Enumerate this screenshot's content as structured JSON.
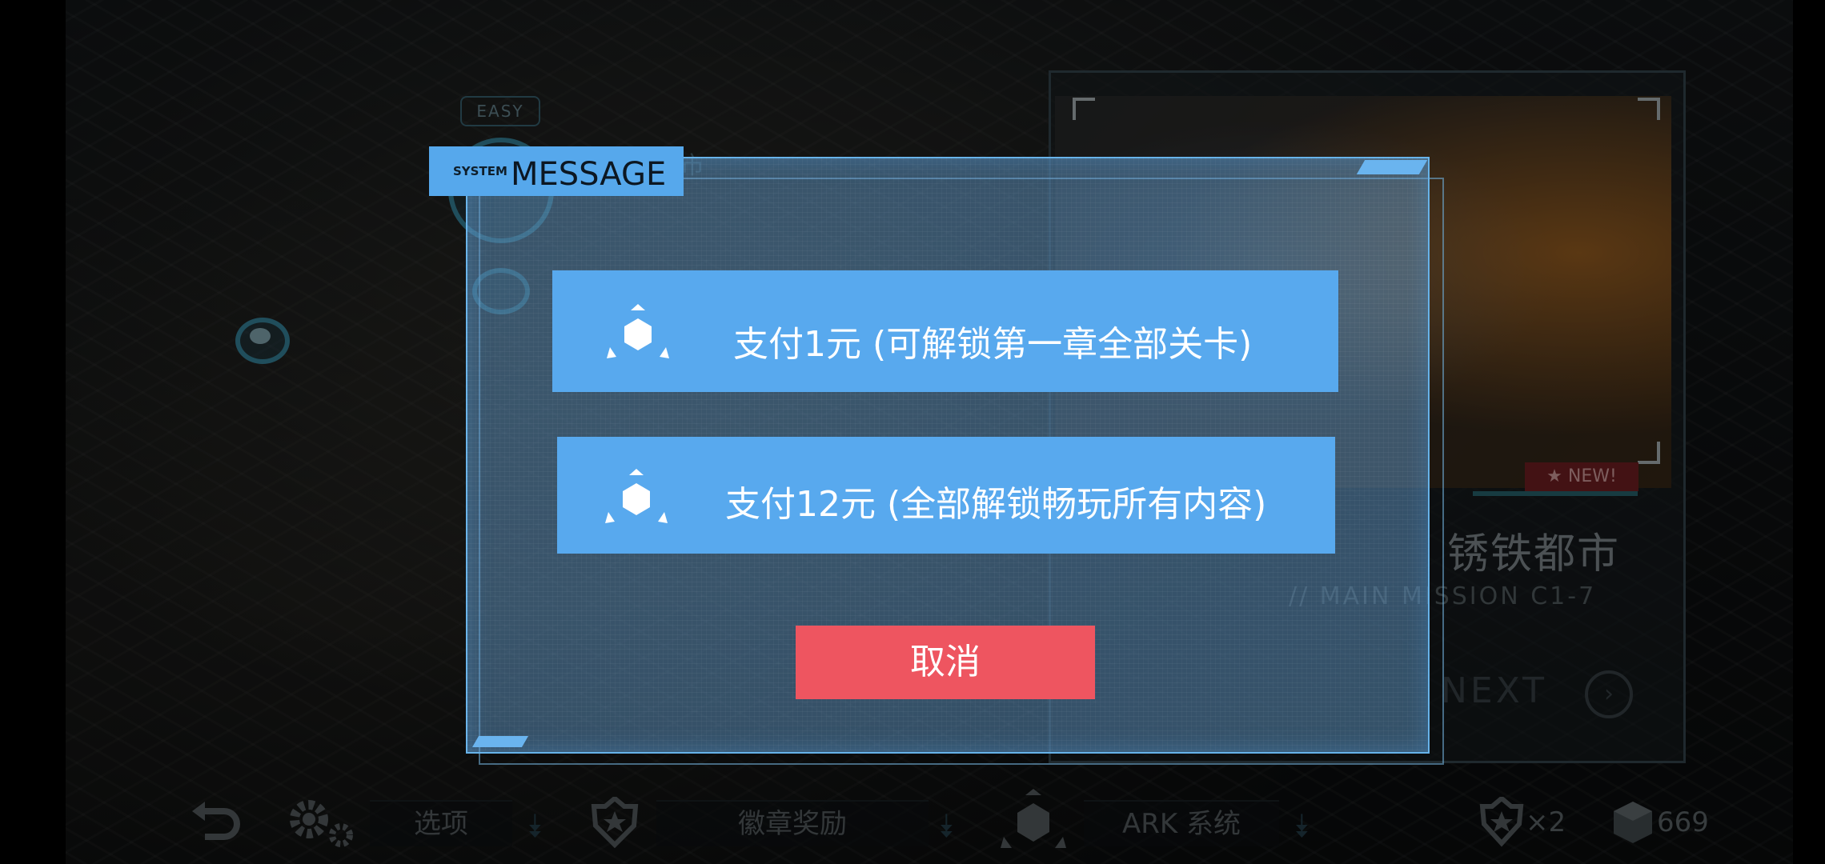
{
  "dialog": {
    "system_tag": "SYSTEM",
    "title": "MESSAGE",
    "option1_label": "支付1元 (可解锁第一章全部关卡)",
    "option2_label": "支付12元 (全部解锁畅玩所有内容)",
    "cancel_label": "取消",
    "option_icon": "cube-icon"
  },
  "background": {
    "difficulty": "EASY",
    "stage_title_partial": "都市",
    "new_badge": "★ NEW!",
    "mission_name": "锈铁都市",
    "mission_code": "// MAIN MISSION C1-7",
    "next_label": "NEXT"
  },
  "toolbar": {
    "back_icon": "back-arrow-icon",
    "settings_icon": "gears-icon",
    "options_label": "选项",
    "badge_icon": "badge-icon",
    "badge_label": "徽章奖励",
    "ark_icon": "cube-icon",
    "ark_label": "ARK 系统",
    "medal_count": "×2",
    "currency_count": "669"
  },
  "colors": {
    "dialog_button": "#58a9ee",
    "cancel_button": "#ee5560",
    "header": "#56a8ec"
  }
}
